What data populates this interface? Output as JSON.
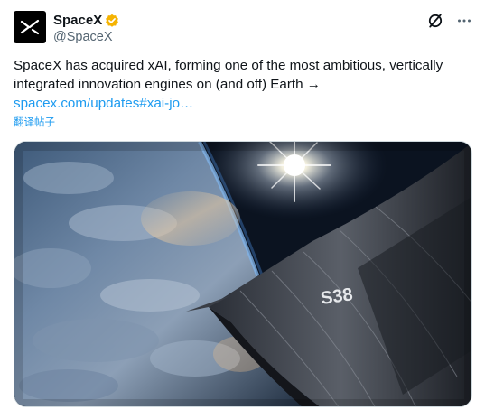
{
  "author": {
    "display_name": "SpaceX",
    "handle": "@SpaceX",
    "avatar_icon": "spacex-logo-icon",
    "verified_icon": "verified-badge-icon",
    "verified_color": "#f5b301"
  },
  "actions": {
    "grok_icon": "grok-icon",
    "more_icon": "more-icon"
  },
  "tweet": {
    "line1": "SpaceX has acquired xAI, forming one of the most ambitious, vertically",
    "line2": "integrated innovation engines on (and off) Earth →",
    "link": "spacex.com/updates#xai-jo…",
    "translate": "翻译帖子"
  },
  "media": {
    "description_icon": "starship-orbit-photo",
    "hull_marking": "S38"
  },
  "colors": {
    "link": "#1d9bf0",
    "text": "#0f1419",
    "secondary": "#536471",
    "border": "#cfd9de"
  }
}
